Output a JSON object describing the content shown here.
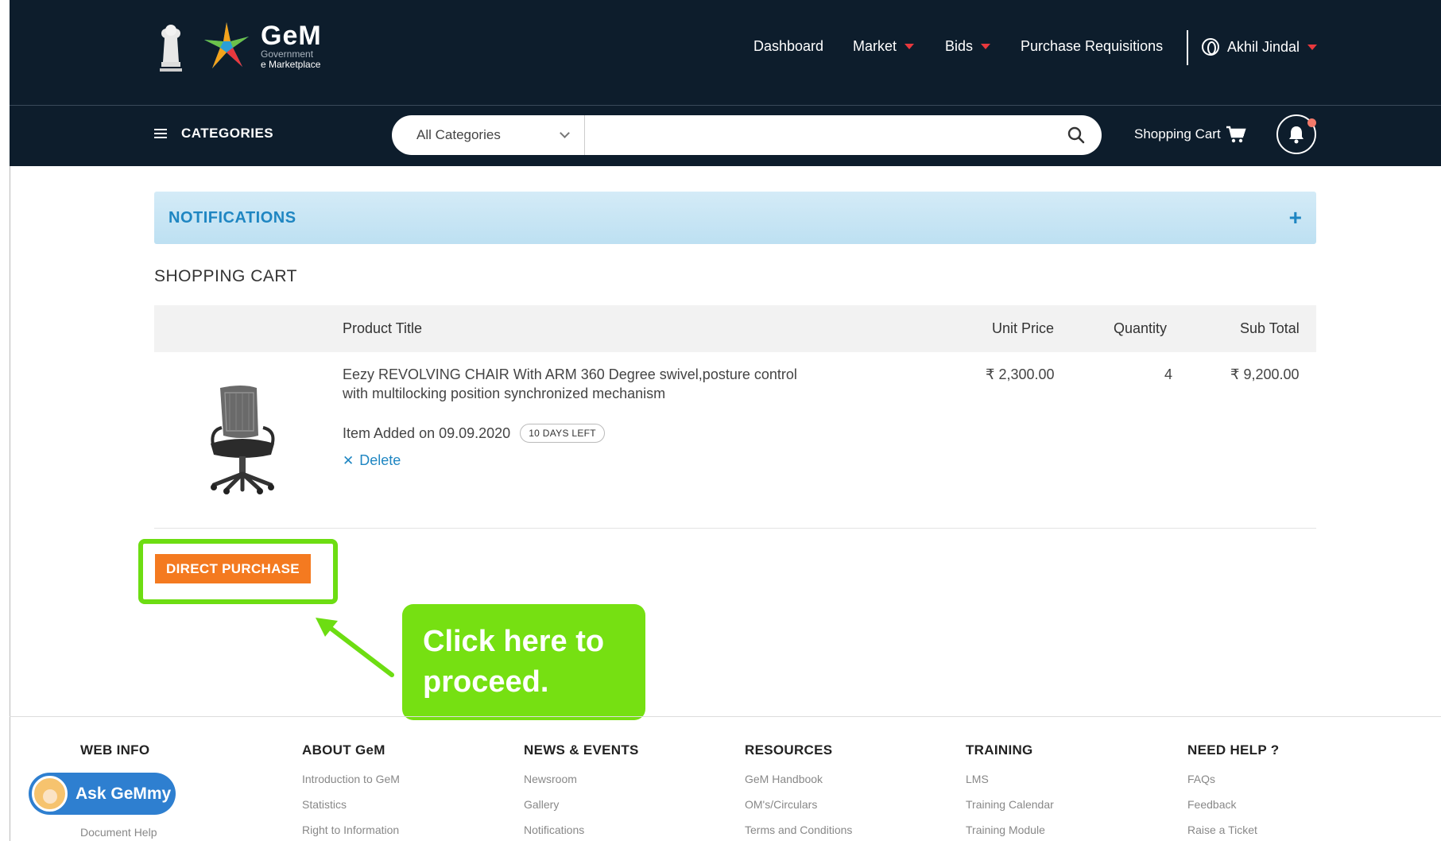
{
  "header": {
    "brand_name": "GeM",
    "brand_line1": "Government",
    "brand_line2": "e Marketplace",
    "nav": {
      "dashboard": "Dashboard",
      "market": "Market",
      "bids": "Bids",
      "purchase_requisitions": "Purchase Requisitions",
      "user": "Akhil Jindal"
    },
    "categories_label": "CATEGORIES",
    "search": {
      "category_value": "All Categories",
      "placeholder": ""
    },
    "cart_label": "Shopping Cart"
  },
  "notifications": {
    "title": "NOTIFICATIONS",
    "expand_symbol": "+"
  },
  "cart": {
    "title": "SHOPPING CART",
    "columns": {
      "product": "Product Title",
      "unit_price": "Unit Price",
      "quantity": "Quantity",
      "sub_total": "Sub Total"
    },
    "item": {
      "title": "Eezy REVOLVING CHAIR With ARM 360 Degree swivel,posture control with multilocking position synchronized mechanism",
      "unit_price": "₹ 2,300.00",
      "quantity": "4",
      "sub_total": "₹ 9,200.00",
      "added": "Item Added on 09.09.2020",
      "days_left": "10 DAYS LEFT",
      "delete_label": "Delete"
    },
    "direct_purchase_label": "DIRECT PURCHASE"
  },
  "callout": {
    "line1": "Click here to",
    "line2": "proceed."
  },
  "footer": {
    "columns": [
      {
        "heading": "WEB INFO",
        "links": []
      },
      {
        "heading": "ABOUT GeM",
        "links": [
          "Introduction to GeM",
          "Statistics",
          "Right to Information"
        ]
      },
      {
        "heading": "NEWS & EVENTS",
        "links": [
          "Newsroom",
          "Gallery",
          "Notifications"
        ]
      },
      {
        "heading": "RESOURCES",
        "links": [
          "GeM Handbook",
          "OM's/Circulars",
          "Terms and Conditions"
        ]
      },
      {
        "heading": "TRAINING",
        "links": [
          "LMS",
          "Training Calendar",
          "Training Module"
        ]
      },
      {
        "heading": "NEED HELP ?",
        "links": [
          "FAQs",
          "Feedback",
          "Raise a Ticket"
        ]
      }
    ],
    "ask_label": "Ask GeMmy",
    "doc_help": "Document Help"
  },
  "colors": {
    "nav_bg": "#0d1d2c",
    "accent_orange": "#f47a20",
    "highlight_green": "#6ddd12",
    "link_blue": "#1f86c2"
  },
  "icons": [
    "national-emblem",
    "gem-star-logo",
    "user-icon",
    "search-icon",
    "cart-icon",
    "bell-icon",
    "close-icon",
    "chair-image",
    "arrow"
  ]
}
